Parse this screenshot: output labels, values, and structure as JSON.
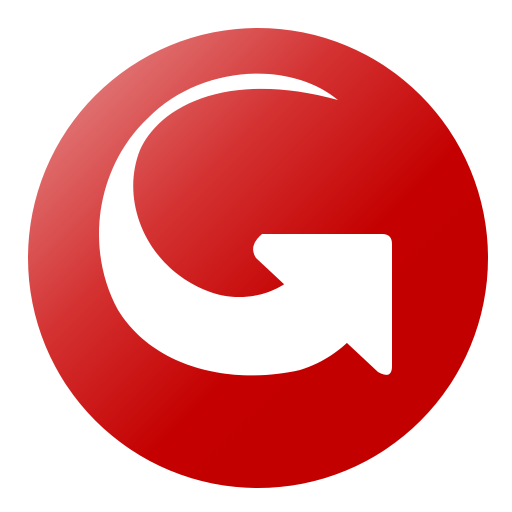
{
  "icon": {
    "name": "redo-arrow-icon",
    "shape": "circle",
    "background_color": "#c40000",
    "highlight_color": "#e89a9a",
    "glyph_color": "#ffffff"
  }
}
